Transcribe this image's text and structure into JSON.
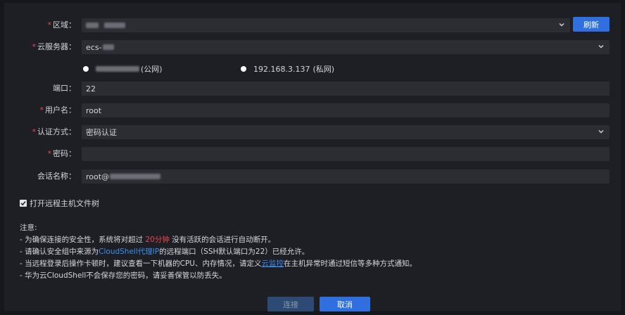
{
  "form": {
    "region": {
      "label": "区域：",
      "required": true
    },
    "refresh_label": "刷新",
    "server": {
      "label": "云服务器：",
      "required": true,
      "value": "ecs-"
    },
    "ip_options": [
      {
        "suffix": "(公网)",
        "selected": true
      },
      {
        "ip": "192.168.3.137",
        "suffix": "(私网)",
        "selected": false
      }
    ],
    "port": {
      "label": "端口：",
      "value": "22"
    },
    "username": {
      "label": "用户名：",
      "required": true,
      "value": "root"
    },
    "auth": {
      "label": "认证方式：",
      "required": true,
      "value": "密码认证"
    },
    "password": {
      "label": "密码：",
      "required": true,
      "value": ""
    },
    "session": {
      "label": "会话名称：",
      "value_prefix": "root@"
    },
    "file_tree": {
      "label": "打开远程主机文件树",
      "checked": true
    }
  },
  "notes": {
    "title": "注意:",
    "line1_a": "- 为确保连接的安全性，系统将对超过 ",
    "line1_highlight": "20分钟",
    "line1_b": " 没有活跃的会话进行自动断开。",
    "line2_a": "- 请确认安全组中来源为",
    "line2_highlight": "CloudShell代理IP",
    "line2_b": "的远程端口（SSH默认端口为22）已经允许。",
    "line3_a": "- 当远程登录后操作卡顿时，建议查看一下机器的CPU、内存情况，请定义",
    "line3_link": "云监控",
    "line3_b": "在主机异常时通过短信等多种方式通知。",
    "line4": "- 华为云CloudShell不会保存您的密码，请妥善保管以防丢失。"
  },
  "footer": {
    "connect_label": "连接",
    "cancel_label": "取消"
  },
  "colors": {
    "accent": "#2f6fe0",
    "required": "#e5484d",
    "highlight_red": "#e5484d",
    "link_blue": "#3a8ef0"
  }
}
